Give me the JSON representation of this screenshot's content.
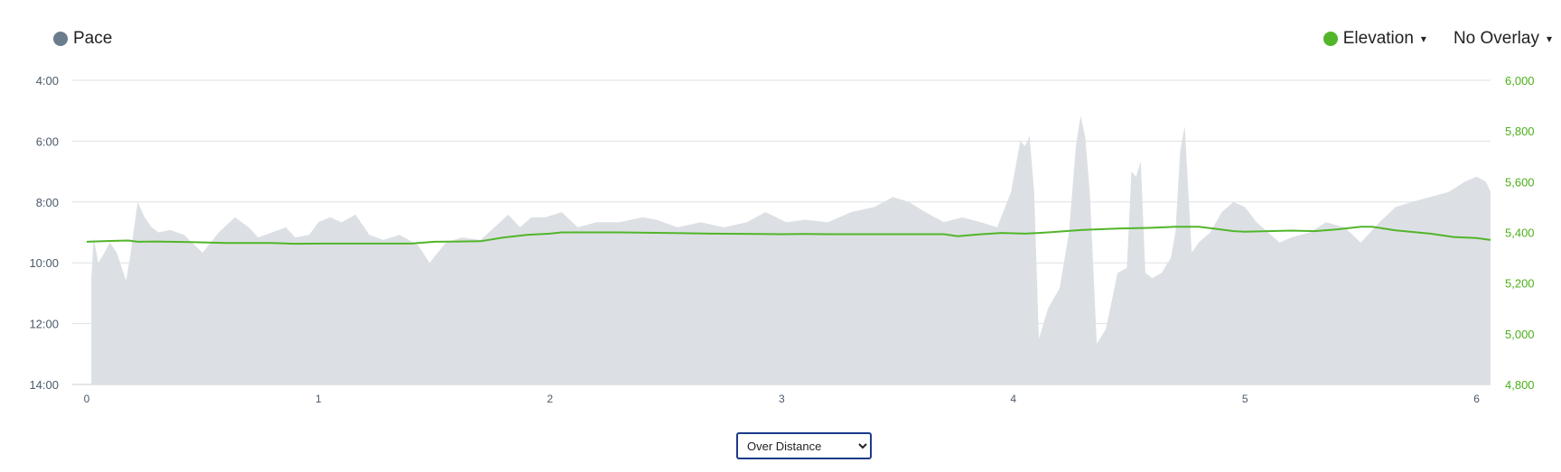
{
  "legend": {
    "pace_label": "Pace",
    "pace_color": "#6b7c8c",
    "elevation_label": "Elevation",
    "elevation_color": "#52b52a",
    "overlay_label": "No Overlay",
    "caret": "▾"
  },
  "control": {
    "selected": "Over Distance",
    "options": [
      "Over Distance"
    ]
  },
  "chart_data": {
    "type": "area",
    "left_axis": {
      "label": "Pace",
      "reversed": true,
      "min_seconds": 240,
      "max_seconds": 840,
      "ticks": [
        "4:00",
        "6:00",
        "8:00",
        "10:00",
        "12:00",
        "14:00"
      ]
    },
    "right_axis": {
      "label": "Elevation",
      "min": 4800,
      "max": 6000,
      "ticks": [
        "6,000",
        "5,800",
        "5,600",
        "5,400",
        "5,200",
        "5,000",
        "4,800"
      ]
    },
    "x_axis": {
      "min": 0,
      "max": 6.06,
      "ticks": [
        "0",
        "1",
        "2",
        "3",
        "4",
        "5",
        "6"
      ]
    },
    "grid": true,
    "series": [
      {
        "name": "Pace",
        "color": "#dce0e4",
        "axis": "left",
        "x": [
          0.02,
          0.03,
          0.05,
          0.07,
          0.1,
          0.13,
          0.17,
          0.19,
          0.22,
          0.25,
          0.28,
          0.31,
          0.36,
          0.42,
          0.5,
          0.57,
          0.64,
          0.7,
          0.74,
          0.8,
          0.86,
          0.9,
          0.96,
          1.0,
          1.05,
          1.1,
          1.16,
          1.22,
          1.28,
          1.35,
          1.43,
          1.48,
          1.55,
          1.62,
          1.7,
          1.76,
          1.82,
          1.87,
          1.92,
          1.98,
          2.05,
          2.12,
          2.2,
          2.3,
          2.4,
          2.46,
          2.55,
          2.65,
          2.75,
          2.85,
          2.93,
          3.02,
          3.1,
          3.2,
          3.3,
          3.4,
          3.48,
          3.55,
          3.62,
          3.7,
          3.78,
          3.86,
          3.93,
          3.99,
          4.03,
          4.05,
          4.07,
          4.09,
          4.11,
          4.15,
          4.2,
          4.24,
          4.27,
          4.29,
          4.31,
          4.33,
          4.36,
          4.4,
          4.45,
          4.49,
          4.51,
          4.53,
          4.55,
          4.57,
          4.6,
          4.64,
          4.68,
          4.7,
          4.72,
          4.74,
          4.77,
          4.8,
          4.85,
          4.9,
          4.95,
          5.0,
          5.05,
          5.1,
          5.15,
          5.2,
          5.28,
          5.35,
          5.43,
          5.5,
          5.58,
          5.65,
          5.72,
          5.8,
          5.88,
          5.95,
          6.0,
          6.04,
          6.06
        ],
        "pace_seconds": [
          630,
          550,
          600,
          585,
          560,
          580,
          635,
          580,
          480,
          510,
          530,
          540,
          535,
          545,
          580,
          540,
          510,
          530,
          550,
          540,
          530,
          550,
          545,
          520,
          510,
          520,
          505,
          545,
          555,
          545,
          565,
          600,
          560,
          550,
          555,
          530,
          505,
          530,
          510,
          510,
          500,
          530,
          520,
          520,
          510,
          515,
          530,
          520,
          530,
          520,
          500,
          520,
          515,
          520,
          500,
          490,
          470,
          480,
          500,
          520,
          510,
          520,
          530,
          460,
          360,
          370,
          350,
          460,
          750,
          690,
          650,
          540,
          370,
          310,
          350,
          460,
          760,
          730,
          620,
          610,
          420,
          430,
          400,
          620,
          630,
          620,
          590,
          540,
          380,
          330,
          580,
          560,
          540,
          500,
          480,
          490,
          520,
          540,
          560,
          550,
          540,
          520,
          530,
          560,
          520,
          490,
          480,
          470,
          460,
          440,
          430,
          440,
          460
        ],
        "elevation_x": [
          0.0,
          0.1,
          0.18,
          0.22,
          0.3,
          0.45,
          0.6,
          0.8,
          0.9,
          1.0,
          1.2,
          1.4,
          1.5,
          1.7,
          1.8,
          1.9,
          2.0,
          2.05,
          2.3,
          2.5,
          2.7,
          2.9,
          3.0,
          3.1,
          3.2,
          3.4,
          3.6,
          3.7,
          3.76,
          3.85,
          3.95,
          4.05,
          4.15,
          4.3,
          4.45,
          4.6,
          4.7,
          4.8,
          4.88,
          4.95,
          5.0,
          5.1,
          5.2,
          5.3,
          5.4,
          5.5,
          5.55,
          5.65,
          5.8,
          5.9,
          6.0,
          6.06
        ],
        "elevation_values": [
          5363,
          5366,
          5368,
          5363,
          5364,
          5362,
          5358,
          5358,
          5355,
          5356,
          5356,
          5356,
          5363,
          5365,
          5380,
          5390,
          5395,
          5400,
          5400,
          5398,
          5395,
          5394,
          5393,
          5394,
          5393,
          5393,
          5393,
          5393,
          5385,
          5392,
          5398,
          5395,
          5400,
          5410,
          5415,
          5418,
          5422,
          5422,
          5413,
          5405,
          5403,
          5405,
          5407,
          5405,
          5412,
          5422,
          5422,
          5408,
          5395,
          5382,
          5378,
          5370
        ]
      },
      {
        "name": "Elevation",
        "color": "#52b52a",
        "axis": "right"
      }
    ]
  }
}
